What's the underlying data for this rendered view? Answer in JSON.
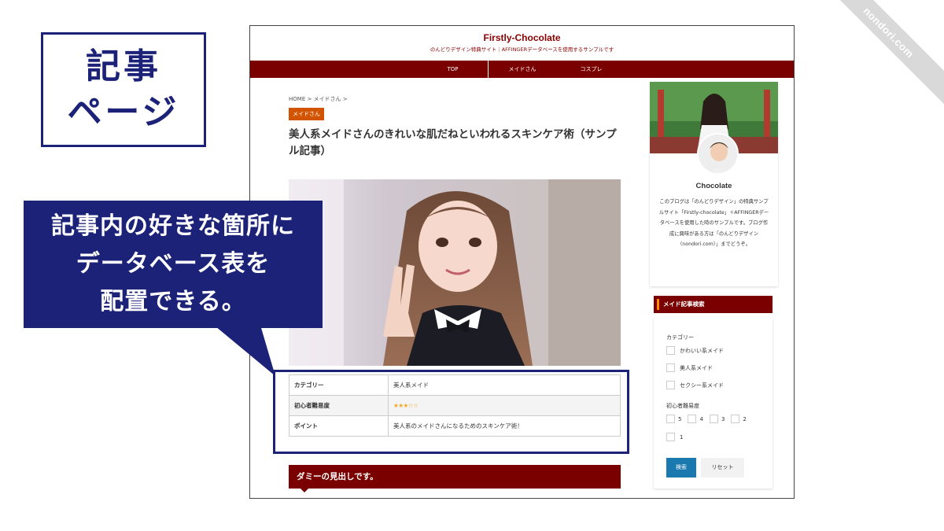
{
  "ribbon": {
    "text": "nondori.com"
  },
  "title_box": {
    "line1": "記事",
    "line2": "ページ"
  },
  "callout": {
    "line1": "記事内の好きな箇所に",
    "line2": "データベース表を",
    "line3": "配置できる。"
  },
  "site": {
    "title": "Firstly-Chocolate",
    "description": "のんどりデザイン特典サイト｜AFFINGERデータベースを使用するサンプルです",
    "nav": [
      "TOP",
      "メイドさん",
      "コスプレ"
    ]
  },
  "article": {
    "breadcrumb": "HOME > メイドさん >",
    "category_badge": "メイドさん",
    "title": "美人系メイドさんのきれいな肌だねといわれるスキンケア術（サンプル記事）",
    "h2": "ダミーの見出しです。"
  },
  "table": {
    "rows": [
      {
        "label": "カテゴリー",
        "value": "美人系メイド"
      },
      {
        "label": "初心者難易度",
        "value": "★★★☆☆"
      },
      {
        "label": "ポイント",
        "value": "美人系のメイドさんになるためのスキンケア術！"
      }
    ]
  },
  "profile": {
    "name": "Chocolate",
    "text": "このブログは「のんどりデザイン」の特典サンプルサイト「Firstly-chocolate」＋AFFINGERデータベースを使用した時のサンプルです。ブログ作成に興味がある方は「のんどりデザイン（nondori.com）」までどうぞ。"
  },
  "search": {
    "heading": "メイド記事検索",
    "category_label": "カテゴリー",
    "categories": [
      "かわいい系メイド",
      "美人系メイド",
      "セクシー系メイド"
    ],
    "difficulty_label": "初心者難易度",
    "difficulty_options": [
      "5",
      "4",
      "3",
      "2",
      "1"
    ],
    "search_button": "検索",
    "reset_button": "リセット"
  },
  "colors": {
    "navy": "#1b2278",
    "maroon": "#7a0000",
    "badge": "#d35400",
    "search_button": "#1a7ab0"
  }
}
